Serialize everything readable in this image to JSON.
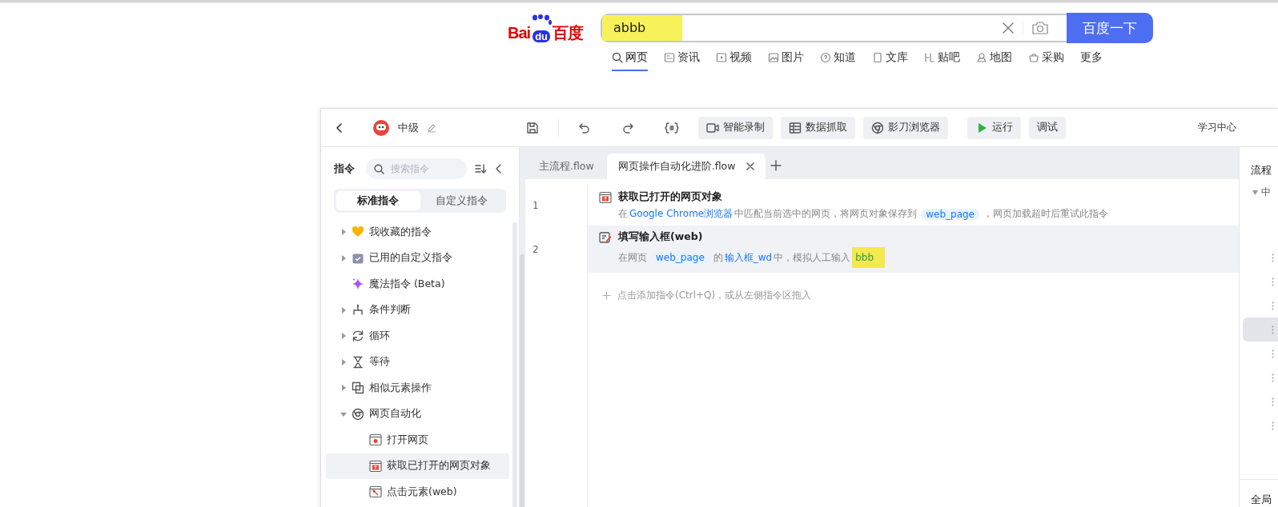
{
  "baidu": {
    "logo": {
      "left": "Bai",
      "paw": "du",
      "right": "百度"
    },
    "search": {
      "value": "abbb",
      "highlighted": true
    },
    "button": "百度一下",
    "nav": [
      {
        "label": "网页",
        "selected": true
      },
      {
        "label": "资讯",
        "selected": false
      },
      {
        "label": "视频",
        "selected": false
      },
      {
        "label": "图片",
        "selected": false
      },
      {
        "label": "知道",
        "selected": false
      },
      {
        "label": "文库",
        "selected": false
      },
      {
        "label": "贴吧",
        "selected": false
      },
      {
        "label": "地图",
        "selected": false
      },
      {
        "label": "采购",
        "selected": false
      },
      {
        "label": "更多",
        "selected": false
      }
    ]
  },
  "app": {
    "project": "中级",
    "toolbar": [
      {
        "kind": "icon"
      },
      {
        "kind": "icon"
      },
      {
        "kind": "icon"
      },
      {
        "kind": "icon"
      },
      {
        "kind": "button",
        "label": "智能录制"
      },
      {
        "kind": "button",
        "label": "数据抓取"
      },
      {
        "kind": "button",
        "label": "影刀浏览器"
      },
      {
        "kind": "button",
        "label": "运行"
      },
      {
        "kind": "button",
        "label": "调试"
      }
    ],
    "help_link": "学习中心",
    "sidebar": {
      "title": "指令",
      "search": {
        "placeholder": "搜索指令"
      },
      "segments": [
        {
          "label": "标准指令",
          "selected": true
        },
        {
          "label": "自定义指令",
          "selected": false
        }
      ],
      "items": [
        {
          "kind": "group",
          "label": "我收藏的指令",
          "expanded": false,
          "selected": false
        },
        {
          "kind": "group",
          "label": "已用的自定义指令",
          "expanded": false,
          "selected": false
        },
        {
          "kind": "command",
          "label": "魔法指令 (Beta)",
          "selected": false
        },
        {
          "kind": "group",
          "label": "条件判断",
          "expanded": false,
          "selected": false
        },
        {
          "kind": "group",
          "label": "循环",
          "expanded": false,
          "selected": false
        },
        {
          "kind": "group",
          "label": "等待",
          "expanded": false,
          "selected": false
        },
        {
          "kind": "group",
          "label": "相似元素操作",
          "expanded": false,
          "selected": false
        },
        {
          "kind": "group",
          "label": "网页自动化",
          "expanded": true,
          "selected": false,
          "children": [
            {
              "kind": "command",
              "label": "打开网页",
              "selected": false
            },
            {
              "kind": "command",
              "label": "获取已打开的网页对象",
              "selected": true
            },
            {
              "kind": "command",
              "label": "点击元素(web)",
              "selected": false
            }
          ]
        }
      ]
    },
    "tabs": [
      {
        "label": "主流程.flow",
        "selected": false
      },
      {
        "label": "网页操作自动化进阶.flow",
        "selected": true
      }
    ],
    "lines": [
      {
        "number": "1",
        "title": "获取已打开的网页对象",
        "selected": false,
        "description": [
          {
            "kind": "text",
            "text": "在"
          },
          {
            "kind": "link",
            "text": "Google Chrome浏览器"
          },
          {
            "kind": "text",
            "text": "中匹配当前选中的网页，将网页对象保存到"
          },
          {
            "kind": "var",
            "text": "web_page"
          },
          {
            "kind": "text",
            "text": "，网页加载超时后重试此指令"
          }
        ]
      },
      {
        "number": "2",
        "title": "填写输入框(web)",
        "selected": true,
        "description": [
          {
            "kind": "text",
            "text": "在网页"
          },
          {
            "kind": "var",
            "text": "web_page"
          },
          {
            "kind": "text",
            "text": "的"
          },
          {
            "kind": "link",
            "text": "输入框_wd"
          },
          {
            "kind": "text",
            "text": "中，模拟人工输入"
          },
          {
            "kind": "value",
            "text": "bbb",
            "highlighted": true
          }
        ]
      }
    ],
    "add_hint": "点击添加指令(Ctrl+Q)，或从左侧指令区拖入",
    "right_panel": {
      "title": "流程",
      "tree_label": "中",
      "rows": [
        {
          "selected": false
        },
        {
          "selected": false
        },
        {
          "selected": false
        },
        {
          "selected": true
        },
        {
          "selected": false
        },
        {
          "selected": false
        },
        {
          "selected": false
        },
        {
          "selected": false
        }
      ],
      "footer": "全局"
    }
  }
}
